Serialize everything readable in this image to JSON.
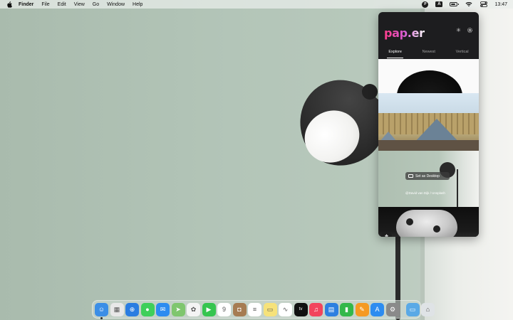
{
  "menubar": {
    "app_name": "Finder",
    "menus": [
      "File",
      "Edit",
      "View",
      "Go",
      "Window",
      "Help"
    ],
    "paper_icon_letter": "P",
    "keyboard_letter": "A",
    "clock": "13:47",
    "battery_level": 0.6
  },
  "popup": {
    "logo": "pap.er",
    "tabs": [
      "Explore",
      "Newest",
      "Vertical"
    ],
    "active_tab": "Explore",
    "set_desktop_label": "Set as Desktop",
    "credit": "@David van Dijk / Unsplash"
  },
  "dock": {
    "apps": [
      {
        "name": "finder",
        "icon": "finder-icon",
        "color": "#3b8ee6",
        "glyph": "☺",
        "running": true
      },
      {
        "name": "launchpad",
        "icon": "launchpad-icon",
        "color": "#e8e8e8",
        "glyph": "▦"
      },
      {
        "name": "safari",
        "icon": "safari-icon",
        "color": "#2a7de1",
        "glyph": "⊕"
      },
      {
        "name": "messages",
        "icon": "messages-icon",
        "color": "#3ecf5a",
        "glyph": "●"
      },
      {
        "name": "mail",
        "icon": "mail-icon",
        "color": "#2d8cf0",
        "glyph": "✉"
      },
      {
        "name": "maps",
        "icon": "maps-icon",
        "color": "#7fc66e",
        "glyph": "➤"
      },
      {
        "name": "photos",
        "icon": "photos-icon",
        "color": "#f4f4f4",
        "glyph": "✿"
      },
      {
        "name": "facetime",
        "icon": "facetime-icon",
        "color": "#35c54f",
        "glyph": "▶"
      },
      {
        "name": "calendar",
        "icon": "calendar-icon",
        "color": "#ffffff",
        "glyph": "9"
      },
      {
        "name": "contacts",
        "icon": "contacts-icon",
        "color": "#a67c52",
        "glyph": "◘"
      },
      {
        "name": "reminders",
        "icon": "reminders-icon",
        "color": "#ffffff",
        "glyph": "≡"
      },
      {
        "name": "notes",
        "icon": "notes-icon",
        "color": "#f6e27a",
        "glyph": "▭"
      },
      {
        "name": "freeform",
        "icon": "freeform-icon",
        "color": "#ffffff",
        "glyph": "∿"
      },
      {
        "name": "tv",
        "icon": "tv-icon",
        "color": "#111111",
        "glyph": "tv"
      },
      {
        "name": "music",
        "icon": "music-icon",
        "color": "#f2445c",
        "glyph": "♫"
      },
      {
        "name": "keynote",
        "icon": "keynote-icon",
        "color": "#2d7fe0",
        "glyph": "▤"
      },
      {
        "name": "numbers",
        "icon": "numbers-icon",
        "color": "#33b84a",
        "glyph": "▮"
      },
      {
        "name": "pages",
        "icon": "pages-icon",
        "color": "#f59a23",
        "glyph": "✎"
      },
      {
        "name": "app-store",
        "icon": "app-store-icon",
        "color": "#2d8cf0",
        "glyph": "A"
      },
      {
        "name": "system-settings",
        "icon": "settings-icon",
        "color": "#8a8a8a",
        "glyph": "⚙"
      }
    ],
    "after_separator": [
      {
        "name": "downloads",
        "icon": "downloads-folder-icon",
        "color": "#5aa9e6",
        "glyph": "▭"
      },
      {
        "name": "trash",
        "icon": "trash-icon",
        "color": "#dfe3e6",
        "glyph": "⌂"
      }
    ]
  }
}
